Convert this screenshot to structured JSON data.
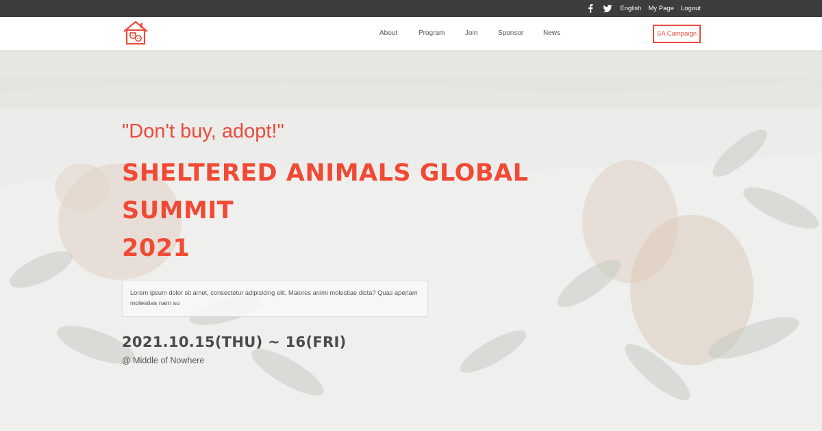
{
  "topbar": {
    "icons": [
      "facebook-icon",
      "twitter-icon"
    ],
    "links": [
      "English",
      "My Page",
      "Logout"
    ]
  },
  "nav": {
    "logo_icon": "pet-house-logo",
    "items": [
      "About",
      "Program",
      "Join",
      "Sponsor",
      "News"
    ],
    "cta": "SA Campaign"
  },
  "hero": {
    "tagline": "\"Don't buy, adopt!\"",
    "headline": [
      "SHELTERED ANIMALS GLOBAL",
      "SUMMIT",
      "2021"
    ],
    "lead": "Lorem ipsum dolor sit amet, consectetur adipisicing elit. Maiores animi molestiae dicta? Quas aperiam molestias nam su",
    "date": "2021.10.15(THU) ~ 16(FRI)",
    "venue": "@ Middle of Nowhere"
  },
  "colors": {
    "accent": "#e94b3c",
    "topbar": "#3d3d3d",
    "text_dark": "#4a4a4a"
  }
}
